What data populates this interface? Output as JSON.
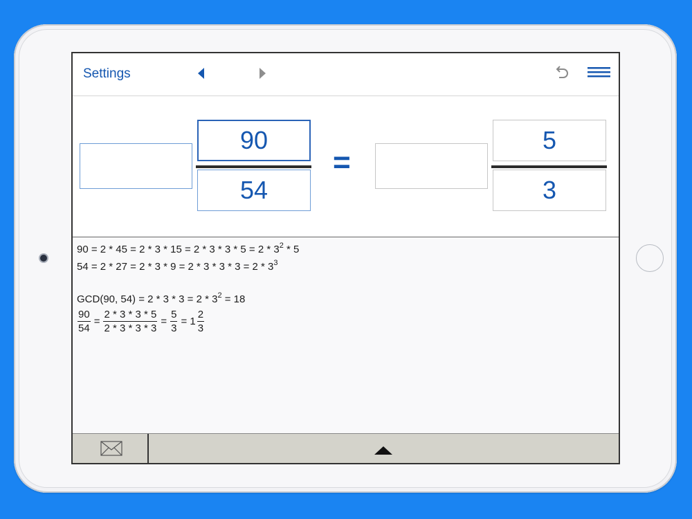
{
  "toolbar": {
    "settings_label": "Settings",
    "icons": [
      "triangle-left-icon",
      "triangle-right-icon",
      "undo-icon",
      "menu-icon"
    ]
  },
  "left_fraction": {
    "whole": "",
    "numerator": "90",
    "denominator": "54"
  },
  "equals_sign": "=",
  "right_fraction": {
    "whole": "",
    "numerator": "5",
    "denominator": "3"
  },
  "steps": {
    "line1": {
      "text": "90 = 2 * 45 = 2 * 3 * 15 = 2 * 3 * 3 * 5 = 2 * 3",
      "sup": "2",
      "tail": " * 5"
    },
    "line2": {
      "text": "54 = 2 * 27 = 2 * 3 * 9 = 2 * 3 * 3 * 3 = 2 * 3",
      "sup": "3"
    },
    "line3": {
      "text": "GCD(90, 54) = 2 * 3 * 3 = 2 * 3",
      "sup": "2",
      "tail": " = 18"
    },
    "line4": {
      "frac1": {
        "n": "90",
        "d": "54"
      },
      "eq1": "=",
      "frac2": {
        "n": "2 * 3 * 3 * 5",
        "d": "2 * 3 * 3 * 3"
      },
      "eq2": "=",
      "frac3": {
        "n": "5",
        "d": "3"
      },
      "eq3": "= 1",
      "frac4": {
        "n": "2",
        "d": "3"
      }
    }
  },
  "bottom_bar": {
    "icons": [
      "mail-icon",
      "triangle-up-icon"
    ]
  },
  "colors": {
    "background": "#1a84f2",
    "accent": "#1557b0",
    "bottom_bar": "#d4d3cb"
  }
}
